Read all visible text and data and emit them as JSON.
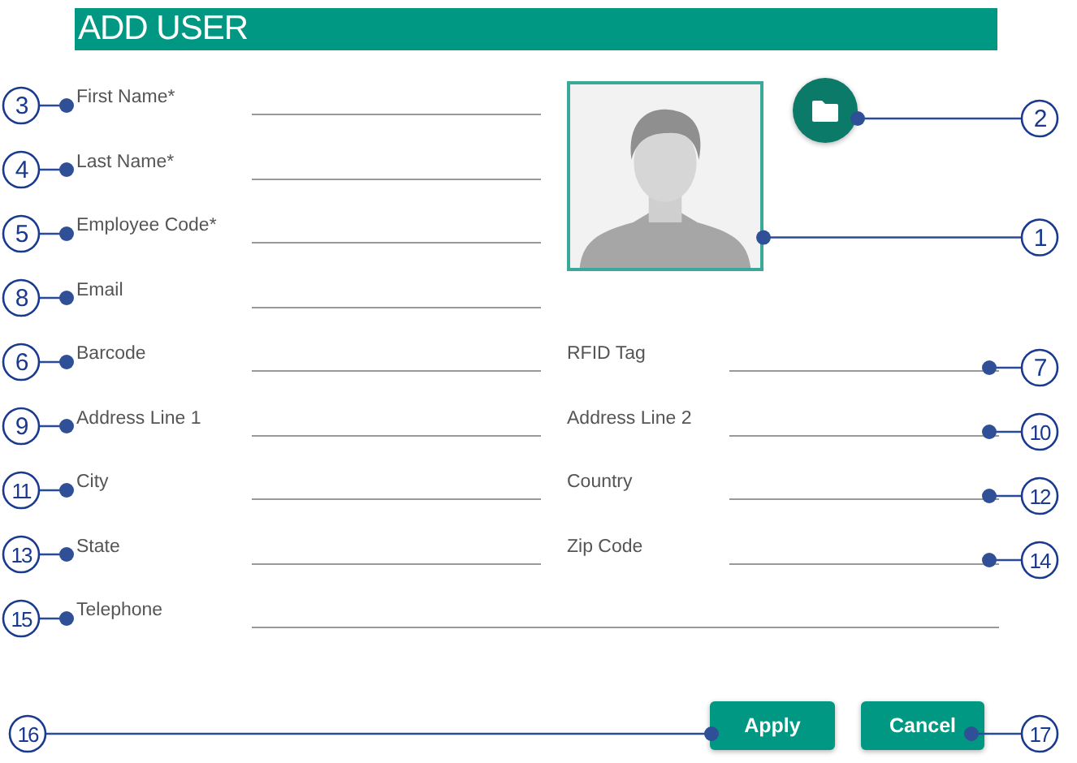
{
  "title": "ADD USER",
  "photo": {
    "callout": "1"
  },
  "upload_button": {
    "callout": "2"
  },
  "top_fields": [
    {
      "label": "First Name*",
      "callout": "3"
    },
    {
      "label": "Last Name*",
      "callout": "4"
    },
    {
      "label": "Employee Code*",
      "callout": "5"
    },
    {
      "label": "Email",
      "callout": "8"
    }
  ],
  "field_rows": [
    [
      {
        "label": "Barcode",
        "callout": "6"
      },
      {
        "label": "RFID Tag",
        "callout": "7"
      }
    ],
    [
      {
        "label": "Address Line 1",
        "callout": "9"
      },
      {
        "label": "Address Line 2",
        "callout": "10"
      }
    ],
    [
      {
        "label": "City",
        "callout": "11"
      },
      {
        "label": "Country",
        "callout": "12"
      }
    ],
    [
      {
        "label": "State",
        "callout": "13"
      },
      {
        "label": "Zip Code",
        "callout": "14"
      }
    ]
  ],
  "wide_fields": [
    {
      "label": "Telephone",
      "callout": "15"
    }
  ],
  "buttons": [
    {
      "label": "Apply",
      "callout": "16"
    },
    {
      "label": "Cancel",
      "callout": "17"
    }
  ]
}
